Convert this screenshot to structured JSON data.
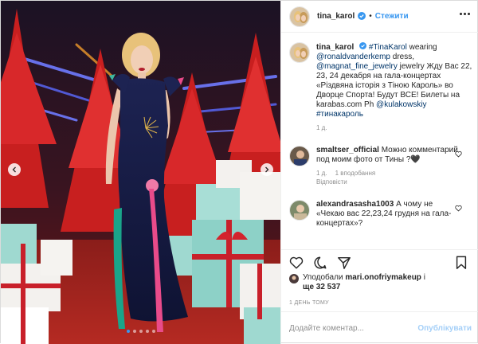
{
  "post": {
    "username": "tina_karol",
    "follow_label": "Стежити",
    "separator": "•",
    "caption": {
      "username": "tina_karol",
      "parts": [
        {
          "text": "#TinaKarol",
          "link": true
        },
        {
          "text": " wearing ",
          "link": false
        },
        {
          "text": "@ronaldvanderkemp",
          "link": true
        },
        {
          "text": " dress, ",
          "link": false
        },
        {
          "text": "@magnat_fine_jewelry",
          "link": true
        },
        {
          "text": " jewelry Жду Вас 22, 23, 24 декабря на гала-концертах «Різдвяна історія з Тіною Кароль» во Дворце Спорта! Будут ВСЕ! Билеты на karabas.com Ph ",
          "link": false
        },
        {
          "text": "@kulakowskiy",
          "link": true
        },
        {
          "text": " ",
          "link": false
        },
        {
          "text": "#тинакароль",
          "link": true
        }
      ],
      "age": "1 д."
    },
    "comments": [
      {
        "username": "smaltser_official",
        "text": "Можно комментарий под моим фото от Тины ?🖤",
        "age": "1 д.",
        "likes": "1 вподобання",
        "reply": "Відповісти"
      },
      {
        "username": "alexandrasasha1003",
        "text": "А чому не «Чекаю вас 22,23,24 грудня на гала-концертах»?",
        "age": "",
        "likes": "",
        "reply": ""
      }
    ],
    "likes": {
      "prefix": "Уподобали ",
      "user": "mari.onofriymakeup",
      "middle": " і ",
      "count": "ще 32 537"
    },
    "time": "1 ДЕНЬ ТОМУ",
    "composer": {
      "placeholder": "Додайте коментар...",
      "post_label": "Опублікувати"
    },
    "carousel": {
      "count": 5,
      "active": 0
    }
  },
  "colors": {
    "accent": "#3897f0",
    "link": "#003569",
    "muted": "#8e8e8e",
    "border": "#efefef"
  },
  "icons": [
    "chevron-left-icon",
    "chevron-right-icon",
    "verified-badge-icon",
    "more-icon",
    "heart-icon",
    "comment-icon",
    "share-icon",
    "bookmark-icon"
  ]
}
